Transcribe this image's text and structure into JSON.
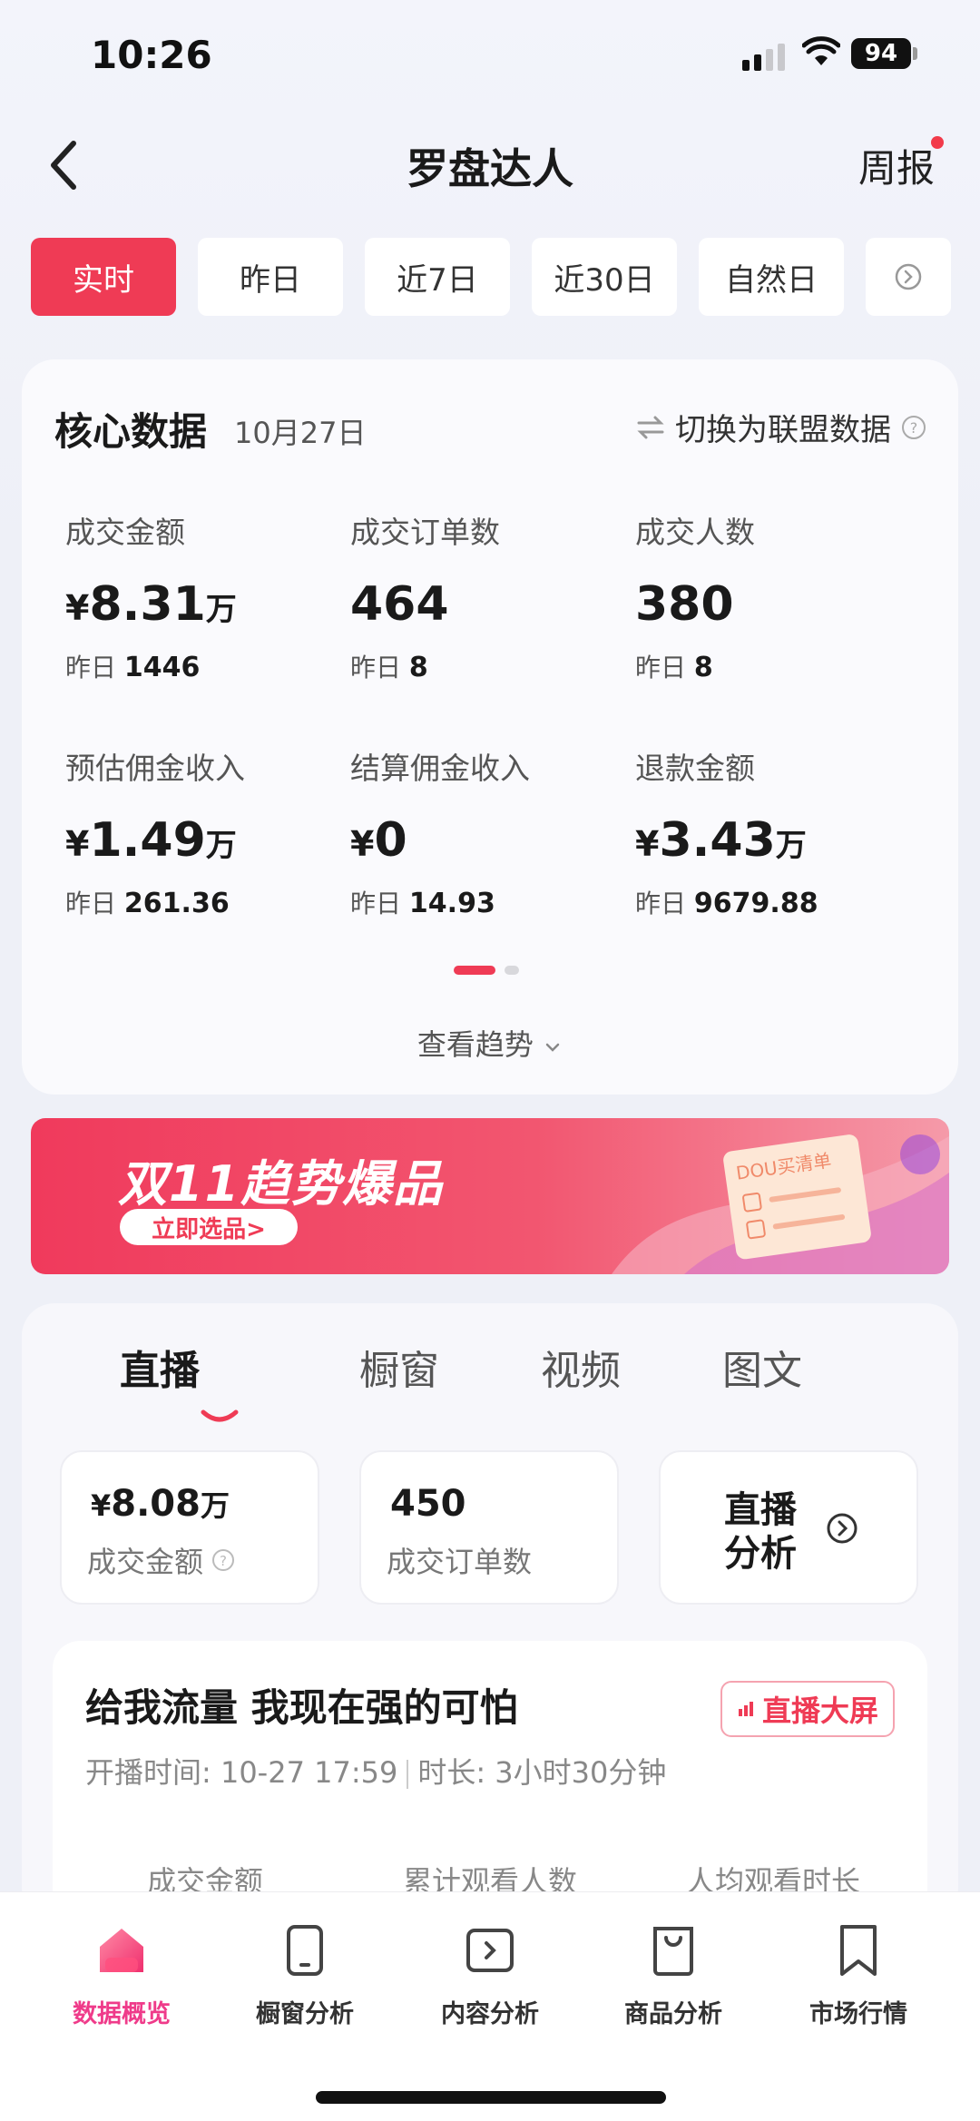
{
  "status_bar": {
    "time": "10:26",
    "battery": "94"
  },
  "header": {
    "back_icon": "chevron-left-icon",
    "title": "罗盘达人",
    "weekly": "周报"
  },
  "time_tabs": [
    {
      "label": "实时",
      "active": true
    },
    {
      "label": "昨日"
    },
    {
      "label": "近7日"
    },
    {
      "label": "近30日"
    },
    {
      "label": "自然日"
    }
  ],
  "core": {
    "title": "核心数据",
    "date": "10月27日",
    "switch_label": "切换为联盟数据",
    "prev_prefix": "昨日",
    "metrics": [
      {
        "label": "成交金额",
        "yen": "¥",
        "value": "8.31",
        "unit": "万",
        "prev": "1446"
      },
      {
        "label": "成交订单数",
        "yen": "",
        "value": "464",
        "unit": "",
        "prev": "8"
      },
      {
        "label": "成交人数",
        "yen": "",
        "value": "380",
        "unit": "",
        "prev": "8"
      },
      {
        "label": "预估佣金收入",
        "yen": "¥",
        "value": "1.49",
        "unit": "万",
        "prev": "261.36"
      },
      {
        "label": "结算佣金收入",
        "yen": "¥",
        "value": "0",
        "unit": "",
        "prev": "14.93"
      },
      {
        "label": "退款金额",
        "yen": "¥",
        "value": "3.43",
        "unit": "万",
        "prev": "9679.88"
      }
    ],
    "trend_link": "查看趋势"
  },
  "banner": {
    "title": "双11趋势爆品",
    "button": "立即选品>",
    "doc_text": "DOU买清单"
  },
  "content": {
    "tabs": [
      {
        "label": "直播",
        "active": true
      },
      {
        "label": "橱窗"
      },
      {
        "label": "视频"
      },
      {
        "label": "图文"
      }
    ],
    "stats": [
      {
        "yen": "¥",
        "value": "8.08",
        "unit": "万",
        "label": "成交金额"
      },
      {
        "yen": "",
        "value": "450",
        "unit": "",
        "label": "成交订单数"
      }
    ],
    "live_analysis": "直播分析",
    "live": {
      "title": "给我流量 我现在强的可怕",
      "screen_button": "直播大屏",
      "start_time": "开播时间: 10-27 17:59",
      "duration": "时长: 3小时30分钟",
      "columns": [
        "成交金额",
        "累计观看人数",
        "人均观看时长"
      ]
    }
  },
  "bottom_nav": [
    {
      "label": "数据概览",
      "icon": "home-icon",
      "active": true
    },
    {
      "label": "橱窗分析",
      "icon": "phone-icon"
    },
    {
      "label": "内容分析",
      "icon": "play-icon"
    },
    {
      "label": "商品分析",
      "icon": "bag-icon"
    },
    {
      "label": "市场行情",
      "icon": "bookmark-icon"
    }
  ],
  "colors": {
    "accent": "#ef3b55",
    "nav_active": "#ef3b8a"
  }
}
